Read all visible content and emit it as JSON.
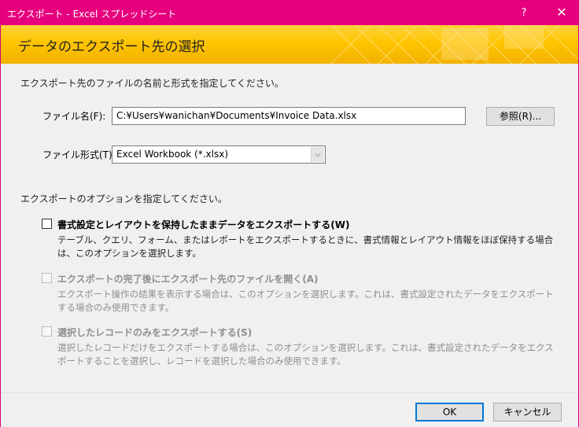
{
  "window": {
    "title": "エクスポート - Excel スプレッドシート",
    "help_label": "?",
    "close_label": "✕"
  },
  "banner": {
    "heading": "データのエクスポート先の選択"
  },
  "main": {
    "instruction": "エクスポート先のファイルの名前と形式を指定してください。",
    "file_name_label": "ファイル名(F):",
    "file_name_value": "C:¥Users¥wanichan¥Documents¥Invoice Data.xlsx",
    "browse_label": "参照(R)...",
    "file_format_label": "ファイル形式(T):",
    "file_format_value": "Excel Workbook (*.xlsx)",
    "options_instruction": "エクスポートのオプションを指定してください。"
  },
  "options": [
    {
      "label": "書式設定とレイアウトを保持したままデータをエクスポートする(W)",
      "description": "テーブル、クエリ、フォーム、またはレポートをエクスポートするときに、書式情報とレイアウト情報をほぼ保持する場合は、このオプションを選択します。",
      "checked": false,
      "enabled": true
    },
    {
      "label": "エクスポートの完了後にエクスポート先のファイルを開く(A)",
      "description": "エクスポート操作の結果を表示する場合は、このオプションを選択します。これは、書式設定されたデータをエクスポートする場合のみ使用できます。",
      "checked": false,
      "enabled": false
    },
    {
      "label": "選択したレコードのみをエクスポートする(S)",
      "description": "選択したレコードだけをエクスポートする場合は、このオプションを選択します。これは、書式設定されたデータをエクスポートすることを選択し、レコードを選択した場合のみ使用できます。",
      "checked": false,
      "enabled": false
    }
  ],
  "footer": {
    "ok_label": "OK",
    "cancel_label": "キャンセル"
  },
  "colors": {
    "titlebar": "#e6007e",
    "banner": "#ffc400",
    "disabled_text": "#8f8f8f"
  },
  "icons": {
    "dropdown": "chevron-down-icon"
  }
}
